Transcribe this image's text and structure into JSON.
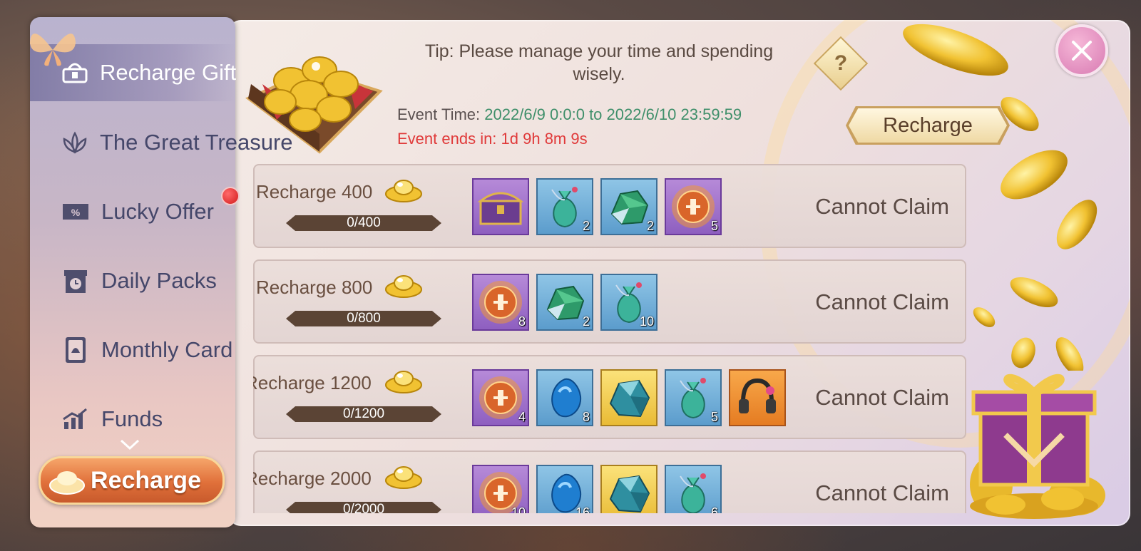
{
  "sidebar": {
    "items": [
      {
        "label": "Recharge Gift",
        "icon": "gift-lock-icon",
        "active": true
      },
      {
        "label": "The Great Treasure",
        "icon": "lotus-icon",
        "active": false
      },
      {
        "label": "Lucky Offer",
        "icon": "discount-ticket-icon",
        "active": false
      },
      {
        "label": "Daily Packs",
        "icon": "timer-gift-icon",
        "active": false
      },
      {
        "label": "Monthly Card",
        "icon": "card-icon",
        "active": false
      },
      {
        "label": "Funds",
        "icon": "chart-up-icon",
        "active": false
      }
    ],
    "recharge_label": "Recharge"
  },
  "header": {
    "tip": "Tip: Please manage your time and spending wisely.",
    "help_label": "?",
    "event_time_label": "Event Time: ",
    "event_time_value": "2022/6/9 0:0:0 to 2022/6/10 23:59:59",
    "event_ends": "Event ends in: 1d 9h 8m 9s",
    "recharge_button": "Recharge"
  },
  "colors": {
    "accent_green": "#3f8f6a",
    "accent_red": "#e03a3a",
    "active_tab": "#7873a0",
    "recharge_orange": "#e0703a"
  },
  "tiers": [
    {
      "title": "Recharge 400",
      "progress": "0/400",
      "progress_fraction": 0,
      "status": "Cannot Claim",
      "items": [
        {
          "type": "chest",
          "rarity": "purple",
          "qty": ""
        },
        {
          "type": "pouch",
          "rarity": "blue",
          "qty": "2"
        },
        {
          "type": "green-ore",
          "rarity": "blue",
          "qty": "2"
        },
        {
          "type": "orb",
          "rarity": "purple",
          "qty": "5"
        }
      ]
    },
    {
      "title": "Recharge 800",
      "progress": "0/800",
      "progress_fraction": 0,
      "status": "Cannot Claim",
      "items": [
        {
          "type": "orb",
          "rarity": "purple",
          "qty": "8"
        },
        {
          "type": "green-ore",
          "rarity": "blue",
          "qty": "2"
        },
        {
          "type": "pouch",
          "rarity": "blue",
          "qty": "10"
        }
      ]
    },
    {
      "title": "Recharge 1200",
      "progress": "0/1200",
      "progress_fraction": 0,
      "status": "Cannot Claim",
      "items": [
        {
          "type": "orb",
          "rarity": "purple",
          "qty": "4"
        },
        {
          "type": "blue-stone",
          "rarity": "blue",
          "qty": "8"
        },
        {
          "type": "crystal-ore",
          "rarity": "gold",
          "qty": ""
        },
        {
          "type": "pouch",
          "rarity": "blue",
          "qty": "5"
        },
        {
          "type": "headphones",
          "rarity": "orange",
          "qty": ""
        }
      ]
    },
    {
      "title": "Recharge 2000",
      "progress": "0/2000",
      "progress_fraction": 0,
      "status": "Cannot Claim",
      "items": [
        {
          "type": "orb",
          "rarity": "purple",
          "qty": "10"
        },
        {
          "type": "blue-stone",
          "rarity": "blue",
          "qty": "16"
        },
        {
          "type": "crystal-ore",
          "rarity": "gold",
          "qty": ""
        },
        {
          "type": "pouch",
          "rarity": "blue",
          "qty": "6"
        }
      ]
    }
  ]
}
